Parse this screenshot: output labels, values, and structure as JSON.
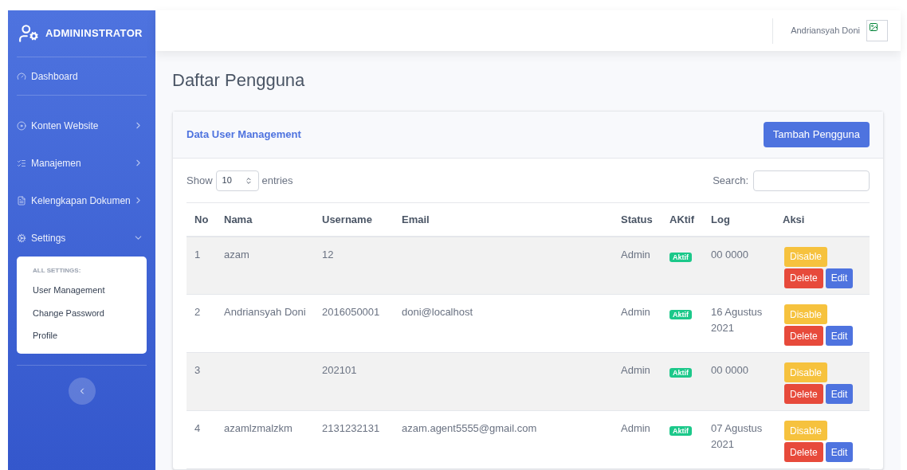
{
  "sidebar": {
    "brand": "ADMININSTRATOR",
    "items": [
      {
        "kind": "link",
        "label": "Dashboard"
      },
      {
        "kind": "menu",
        "label": "Konten Website",
        "expanded": false
      },
      {
        "kind": "menu",
        "label": "Manajemen",
        "expanded": false
      },
      {
        "kind": "menu",
        "label": "Kelengkapan Dokumen",
        "expanded": false
      },
      {
        "kind": "menu",
        "label": "Settings",
        "expanded": true,
        "submenu": {
          "heading": "ALL SETTINGS:",
          "items": [
            "User Management",
            "Change Password",
            "Profile"
          ]
        }
      }
    ]
  },
  "topbar": {
    "user_name": "Andriansyah Doni"
  },
  "page_title": "Daftar Pengguna",
  "card": {
    "title": "Data User Management",
    "add_button": "Tambah Pengguna",
    "show_label": "Show",
    "entries_value": "10",
    "entries_label": "entries",
    "search_label": "Search:",
    "table": {
      "columns": [
        "No",
        "Nama",
        "Username",
        "Email",
        "Status",
        "AKtif",
        "Log",
        "Aksi"
      ],
      "rows": [
        {
          "no": "1",
          "nama": "azam",
          "username": "12",
          "email": "",
          "status": "Admin",
          "aktif": "Aktif",
          "log": "00 0000",
          "actions": [
            "Disable",
            "Delete",
            "Edit"
          ]
        },
        {
          "no": "2",
          "nama": "Andriansyah Doni",
          "username": "2016050001",
          "email": "doni@localhost",
          "status": "Admin",
          "aktif": "Aktif",
          "log": "16 Agustus 2021",
          "actions": [
            "Disable",
            "Delete",
            "Edit"
          ]
        },
        {
          "no": "3",
          "nama": "",
          "username": "202101",
          "email": "",
          "status": "Admin",
          "aktif": "Aktif",
          "log": "00 0000",
          "actions": [
            "Disable",
            "Delete",
            "Edit"
          ]
        },
        {
          "no": "4",
          "nama": "azamlzmalzkm",
          "username": "2131232131",
          "email": "azam.agent5555@gmail.com",
          "status": "Admin",
          "aktif": "Aktif",
          "log": "07 Agustus 2021",
          "actions": [
            "Disable",
            "Delete",
            "Edit"
          ]
        }
      ]
    }
  }
}
